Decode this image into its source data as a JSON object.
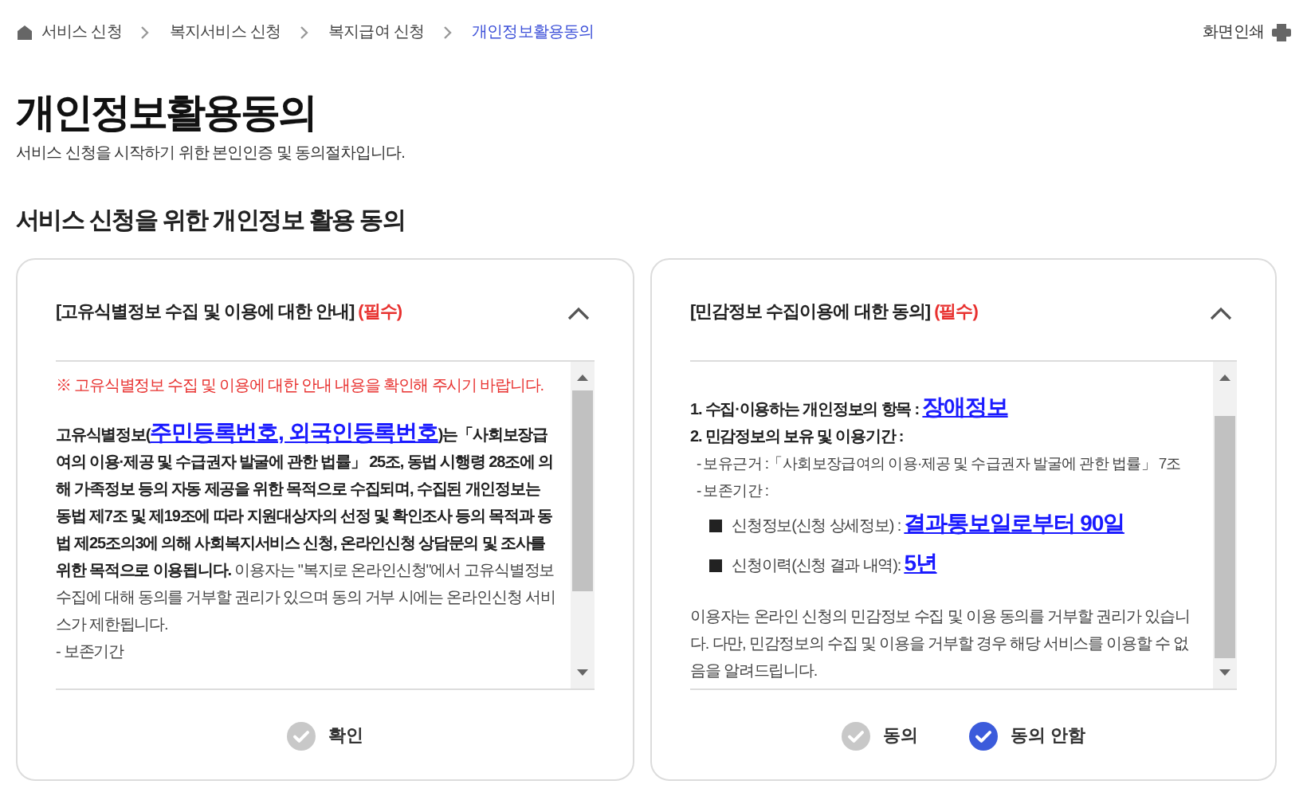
{
  "breadcrumb": [
    {
      "label": "서비스 신청",
      "selected": false
    },
    {
      "label": "복지서비스 신청",
      "selected": false
    },
    {
      "label": "복지급여 신청",
      "selected": false
    },
    {
      "label": "개인정보활용동의",
      "selected": true
    }
  ],
  "print_button": "화면인쇄",
  "title": "개인정보활용동의",
  "subtitle": "서비스 신청을 시작하기 위한 본인인증 및 동의절차입니다.",
  "section_title": "서비스 신청을 위한 개인정보 활용 동의",
  "panels": [
    {
      "title": "[고유식별정보 수집 및 이용에 대한 안내]",
      "required": "(필수)",
      "expanded": true,
      "lines": [
        {
          "kind": "notice",
          "segments": [
            {
              "kind": "notice",
              "text": "※ 고유식별정보 수집 및 이용에 대한 안내 내용을 확인해 주시기 바랍니다."
            }
          ]
        },
        {
          "kind": "spacer"
        },
        {
          "kind": "para",
          "segments": [
            {
              "kind": "bold",
              "text": "고유식별정보("
            },
            {
              "kind": "link",
              "text": "주민등록번호, 외국인등록번호"
            },
            {
              "kind": "bold",
              "text": ")는「사회보장급여의 이용·제공 및 수급권자 발굴에 관한 법률」 25조, 동법 시행령 28조에 의해 가족정보 등의 자동 제공을 위한 목적으로 수집되며, 수집된 개인정보는 동법 제7조 및 제19조에 따라 지원대상자의 선정 및 확인조사 등의 목적과 동법 제25조의3에 의해 사회복지서비스 신청, 온라인신청 상담문의 및 조사를 위한 목적으로 이용됩니다. "
            },
            {
              "kind": "normal",
              "text": "이용자는 \"복지로 온라인신청\"에서 고유식별정보 수집에 대해 동의를 거부할 권리가 있으며 동의 거부 시에는 온라인신청 서비스가 제한됩니다."
            }
          ]
        },
        {
          "kind": "para",
          "segments": [
            {
              "kind": "normal",
              "text": "- 보존기간"
            }
          ]
        }
      ],
      "options": [
        {
          "label": "확인",
          "selected": false
        }
      ]
    },
    {
      "title": "[민감정보 수집이용에 대한 동의]",
      "required": "(필수)",
      "expanded": true,
      "lines": [
        {
          "kind": "spacer"
        },
        {
          "kind": "para",
          "segments": [
            {
              "kind": "bold",
              "text": "1. 수집·이용하는 개인정보의 항목 : "
            },
            {
              "kind": "link",
              "text": "장애정보"
            }
          ]
        },
        {
          "kind": "para",
          "segments": [
            {
              "kind": "bold",
              "text": "2. 민감정보의 보유 및 이용기간 :"
            }
          ]
        },
        {
          "kind": "sub",
          "segments": [
            {
              "kind": "normal",
              "text": "- 보유근거 :「사회보장급여의 이용·제공 및 수급권자 발굴에 관한 법률」 7조"
            }
          ]
        },
        {
          "kind": "sub",
          "segments": [
            {
              "kind": "normal",
              "text": "- 보존기간 :"
            }
          ]
        },
        {
          "kind": "bullet",
          "segments": [
            {
              "kind": "normal",
              "text": "신청정보(신청 상세정보) : "
            },
            {
              "kind": "link",
              "text": "결과통보일로부터 90일"
            }
          ]
        },
        {
          "kind": "bullet",
          "segments": [
            {
              "kind": "normal",
              "text": "신청이력(신청 결과 내역): "
            },
            {
              "kind": "link",
              "text": "5년"
            }
          ]
        },
        {
          "kind": "spacer"
        },
        {
          "kind": "para",
          "segments": [
            {
              "kind": "normal",
              "text": "이용자는 온라인 신청의 민감정보 수집 및 이용 동의를 거부할 권리가 있습니다. 다만, 민감정보의 수집 및 이용을 거부할 경우 해당 서비스를 이용할 수 없음을 알려드립니다."
            }
          ]
        }
      ],
      "options": [
        {
          "label": "동의",
          "selected": false
        },
        {
          "label": "동의 안함",
          "selected": true
        }
      ]
    }
  ]
}
